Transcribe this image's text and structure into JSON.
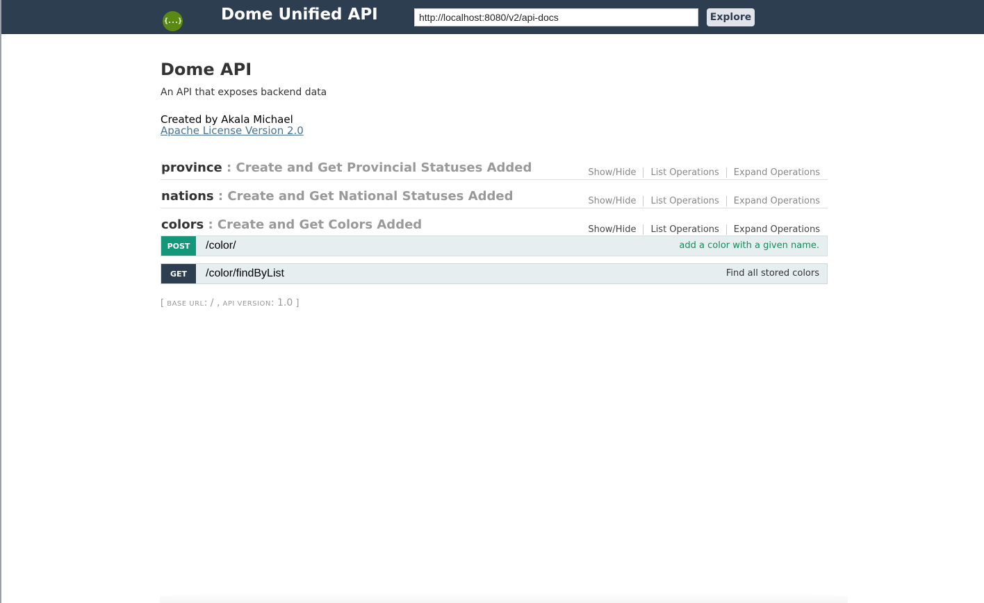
{
  "header": {
    "logo_text": "{...}",
    "title": "Dome Unified API",
    "url_value": "http://localhost:8080/v2/api-docs",
    "explore_label": "Explore"
  },
  "info": {
    "title": "Dome API",
    "description": "An API that exposes backend data",
    "contact": "Created by Akala Michael",
    "license": "Apache License Version 2.0"
  },
  "resources": [
    {
      "name": "province",
      "description": ": Create and Get Provincial Statuses Added",
      "ops": [
        "Show/Hide",
        "List Operations",
        "Expand Operations"
      ]
    },
    {
      "name": "nations",
      "description": ": Create and Get National Statuses Added",
      "ops": [
        "Show/Hide",
        "List Operations",
        "Expand Operations"
      ]
    },
    {
      "name": "colors",
      "description": ": Create and Get Colors Added",
      "ops": [
        "Show/Hide",
        "List Operations",
        "Expand Operations"
      ]
    }
  ],
  "operations": [
    {
      "method": "POST",
      "path": "/color/",
      "summary": "add a color with a given name."
    },
    {
      "method": "GET",
      "path": "/color/findByList",
      "summary": "Find all stored colors"
    }
  ],
  "footer": {
    "open": "[",
    "base_url_label": "base url",
    "base_url_value": ": / ,",
    "api_version_label": "api version",
    "api_version_value": ": 1.0",
    "close": "]"
  },
  "colors": {
    "header_bg": "#2c3e50",
    "post": "#14967a",
    "get": "#2c3e50",
    "logo": "#5a8a13"
  }
}
